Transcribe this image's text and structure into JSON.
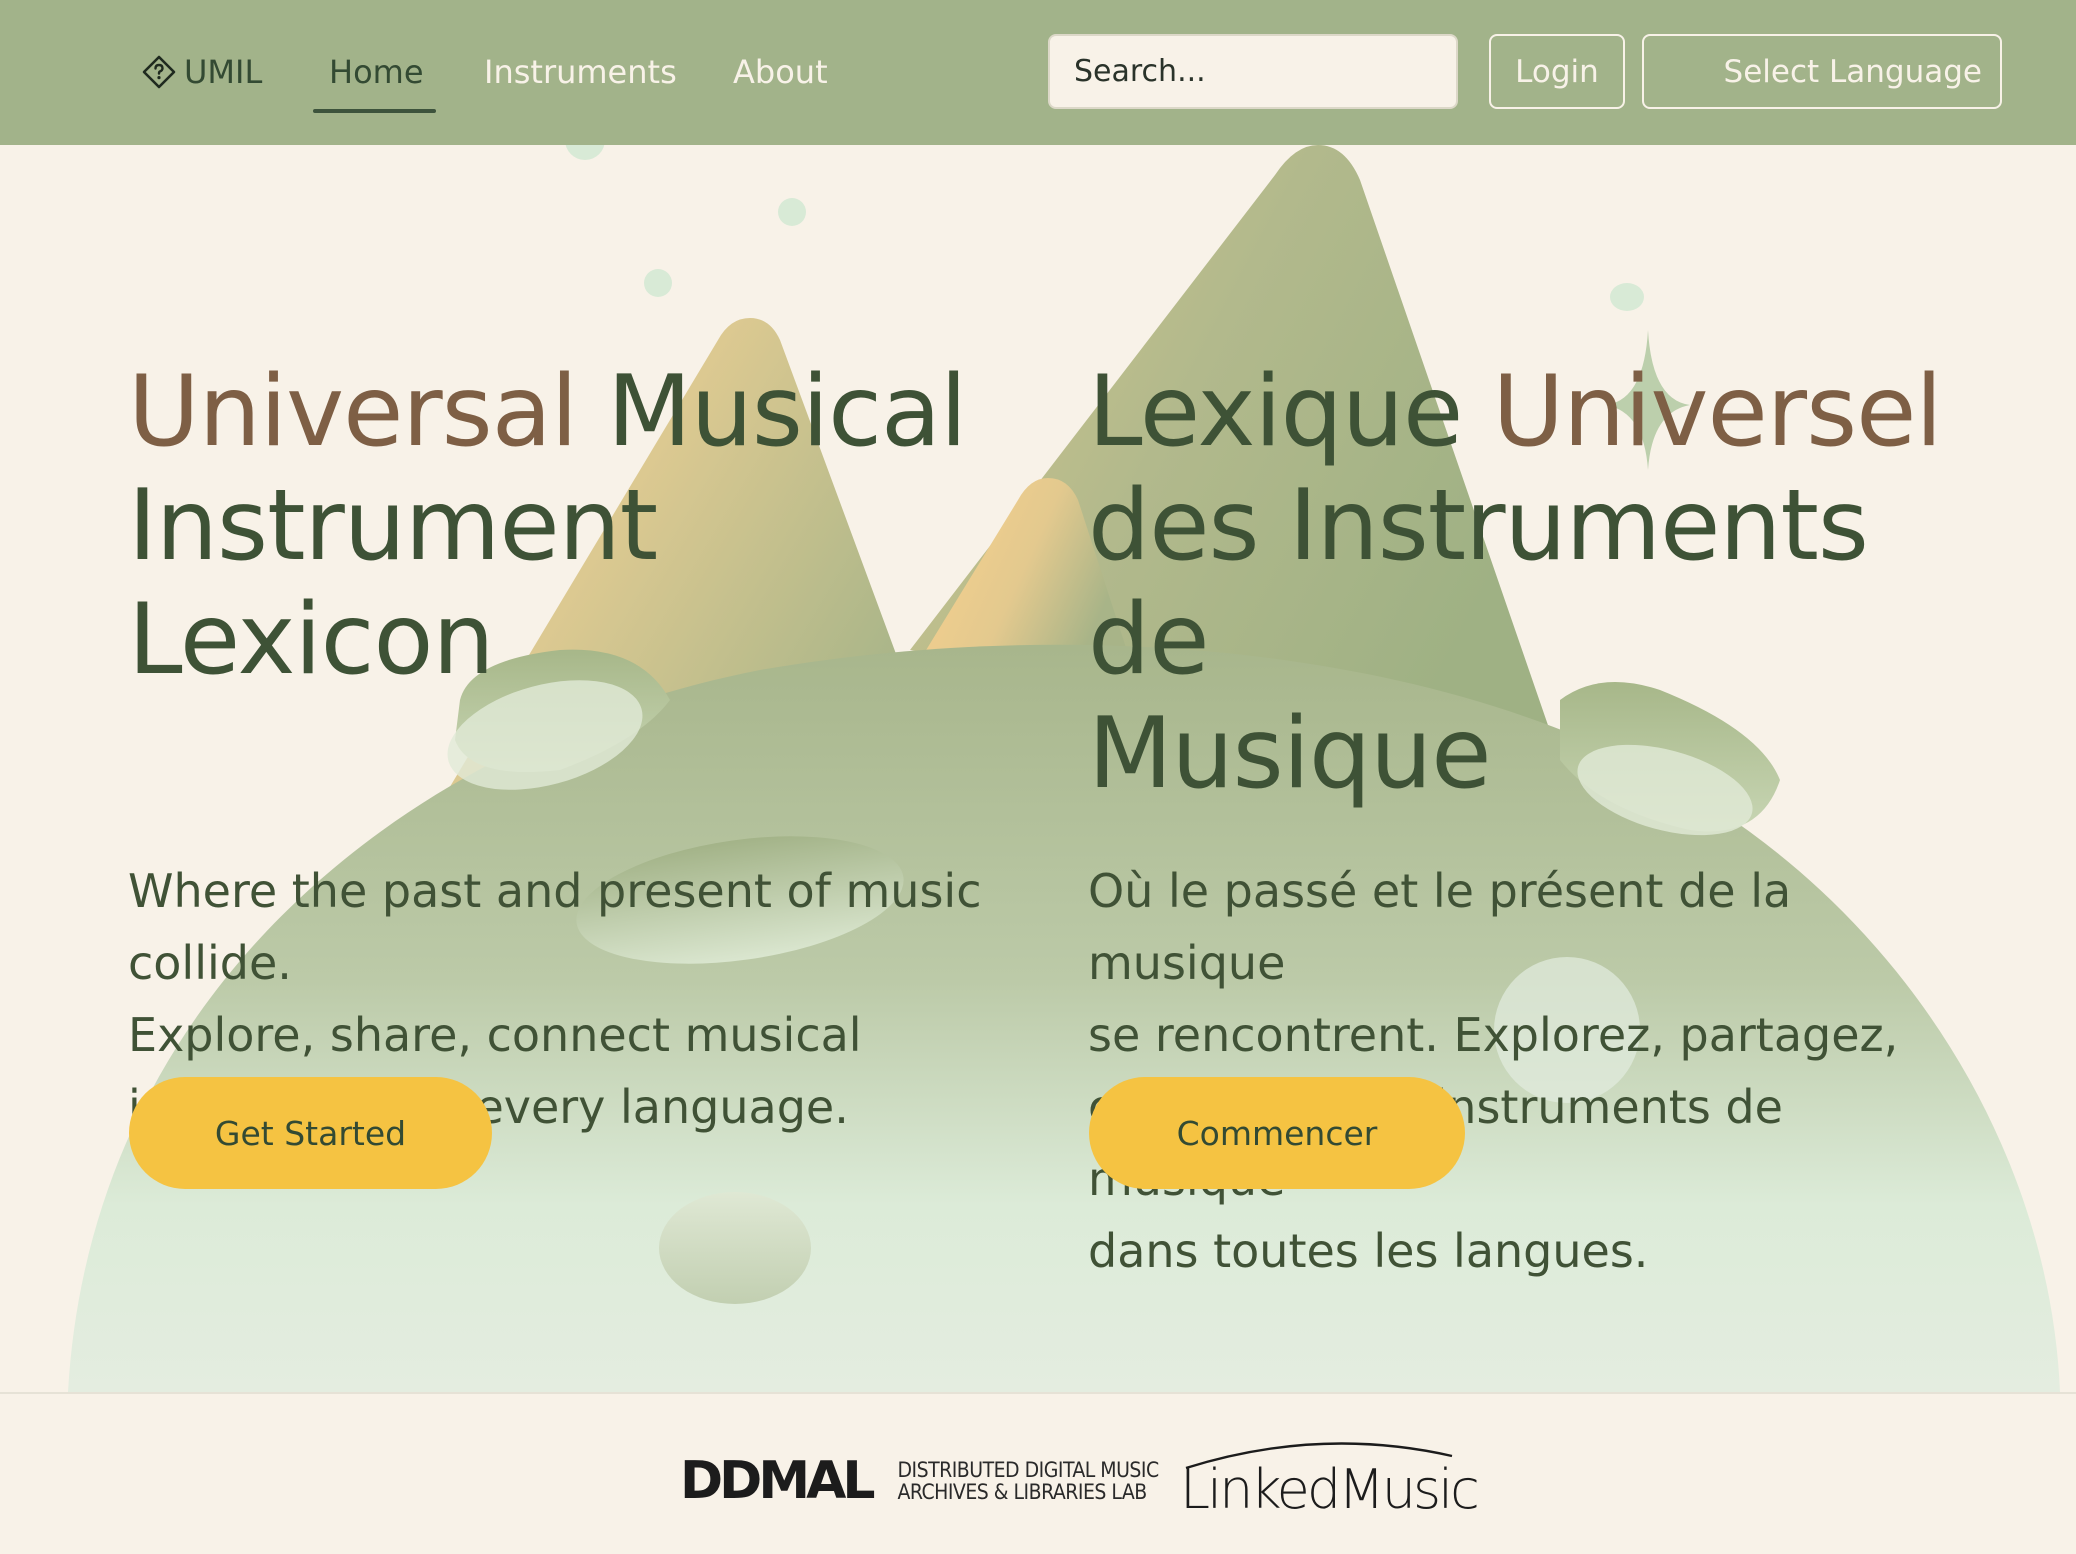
{
  "navbar": {
    "brand": "UMIL",
    "links": [
      {
        "label": "Home",
        "active": true
      },
      {
        "label": "Instruments",
        "active": false
      },
      {
        "label": "About",
        "active": false
      }
    ],
    "search_placeholder": "Search...",
    "login_label": "Login",
    "language_label": "Select Language"
  },
  "hero": {
    "en": {
      "title_accent": "Universal",
      "title_rest_line1": " Musical",
      "title_line2": "Instrument Lexicon",
      "desc_line1": "Where the past and present of music",
      "desc_line2": "collide.",
      "desc_line3": "Explore, share, connect musical",
      "desc_line4": "instruments in every language.",
      "cta": "Get Started"
    },
    "fr": {
      "title_start": "Lexique ",
      "title_accent": "Universel",
      "title_line2": "des Instruments de",
      "title_line3": "Musique",
      "desc_line1": "Où le passé et le présent de la musique",
      "desc_line2": "se rencontrent. Explorez, partagez,",
      "desc_line3": "connectez des instruments de musique",
      "desc_line4": "dans toutes les langues.",
      "cta": "Commencer"
    }
  },
  "footer": {
    "ddmal_mark": "DDMAL",
    "ddmal_line1": "DISTRIBUTED DIGITAL MUSIC",
    "ddmal_line2": "ARCHIVES & LIBRARIES LAB",
    "linkedmusic": "LinkedMusic"
  },
  "colors": {
    "navbar": "#a2b38a",
    "background": "#f8f2e8",
    "heading": "#3e5236",
    "accent": "#7e5f45",
    "cta": "#f5c342"
  },
  "icons": {
    "brand_icon": "diamond-question-icon"
  }
}
